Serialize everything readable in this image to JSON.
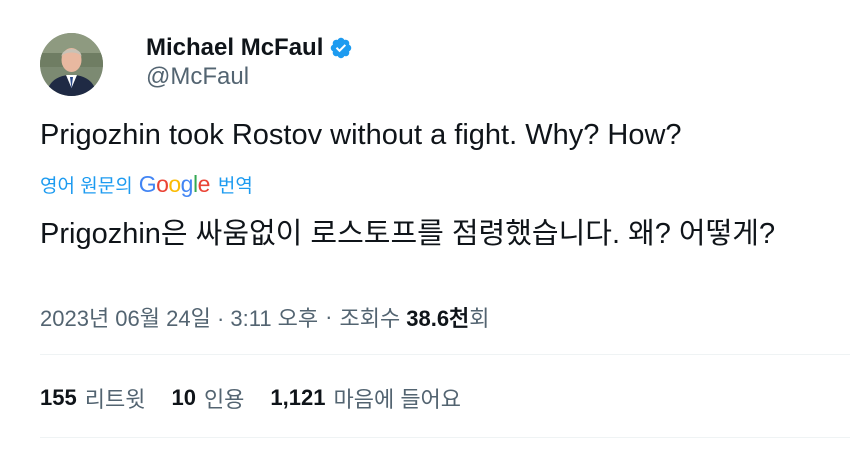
{
  "author": {
    "display_name": "Michael McFaul",
    "handle": "@McFaul",
    "avatar_icon": "profile-photo",
    "verified_icon": "verified-badge-icon",
    "verified_color": "#1d9bf0"
  },
  "tweet": {
    "text": "Prigozhin took Rostov without a fight. Why? How?",
    "translate_prefix": "영어 원문의",
    "translate_suffix": "번역",
    "translated_text": "Prigozhin은 싸움없이 로스토프를 점령했습니다. 왜? 어떻게?"
  },
  "meta": {
    "timestamp": "2023년 06월 24일 · 3:11 오후",
    "separator": "·",
    "views_label_prefix": "조회수",
    "views_count": "38.6천",
    "views_label_suffix": "회"
  },
  "stats": {
    "retweets_count": "155",
    "retweets_label": "리트윗",
    "quotes_count": "10",
    "quotes_label": "인용",
    "likes_count": "1,121",
    "likes_label": "마음에 들어요"
  },
  "colors": {
    "text": "#0f1419",
    "secondary": "#536471",
    "accent": "#1d9bf0",
    "divider": "#eff3f4"
  }
}
